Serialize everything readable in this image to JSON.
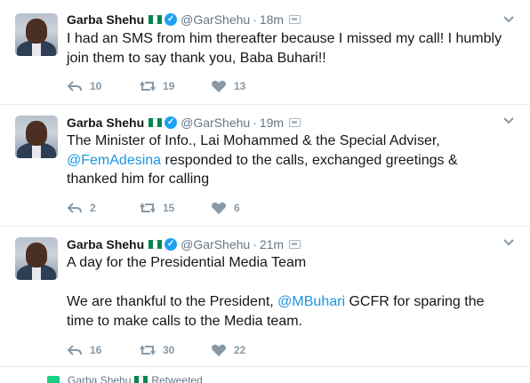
{
  "tweets": [
    {
      "name": "Garba Shehu",
      "handle": "@GarShehu",
      "time": "18m",
      "text_parts": [
        "I had an SMS from him thereafter because I missed my call! I humbly join them to say thank you, Baba Buhari!!"
      ],
      "replies": "10",
      "retweets": "19",
      "likes": "13"
    },
    {
      "name": "Garba Shehu",
      "handle": "@GarShehu",
      "time": "19m",
      "text_a": "The Minister of Info., Lai Mohammed & the Special Adviser, ",
      "mention": "@FemAdesina",
      "text_b": " responded to the calls, exchanged greetings & thanked him for calling",
      "replies": "2",
      "retweets": "15",
      "likes": "6"
    },
    {
      "name": "Garba Shehu",
      "handle": "@GarShehu",
      "time": "21m",
      "line1": "A day for the Presidential Media Team",
      "text_a": "We are thankful to the President, ",
      "mention": "@MBuhari",
      "text_b": " GCFR for sparing the time to make calls to the Media team.",
      "replies": "16",
      "retweets": "30",
      "likes": "22"
    }
  ],
  "retweeted_bar": {
    "name": "Garba Shehu",
    "label": "Retweeted"
  },
  "colors": {
    "link": "#1b95e0",
    "verified": "#1da1f2",
    "action_gray": "#8899a6",
    "flag_green": "#008751"
  },
  "icons": [
    "reply-icon",
    "retweet-icon",
    "like-icon",
    "verified-icon",
    "chevron-down-icon",
    "device-icon"
  ]
}
